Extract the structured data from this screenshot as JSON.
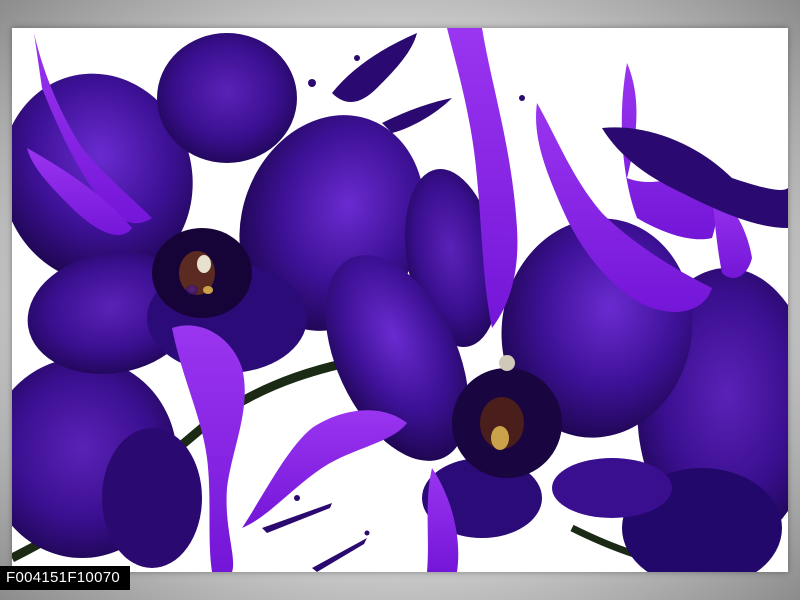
{
  "product": {
    "code": "F004151F10070"
  },
  "artwork": {
    "background_color": "#ffffff",
    "petal_color": "#3a0f8f",
    "petal_dark_color": "#1c0650",
    "paint_color": "#8a1fe6",
    "center_color": "#c9a24a"
  }
}
